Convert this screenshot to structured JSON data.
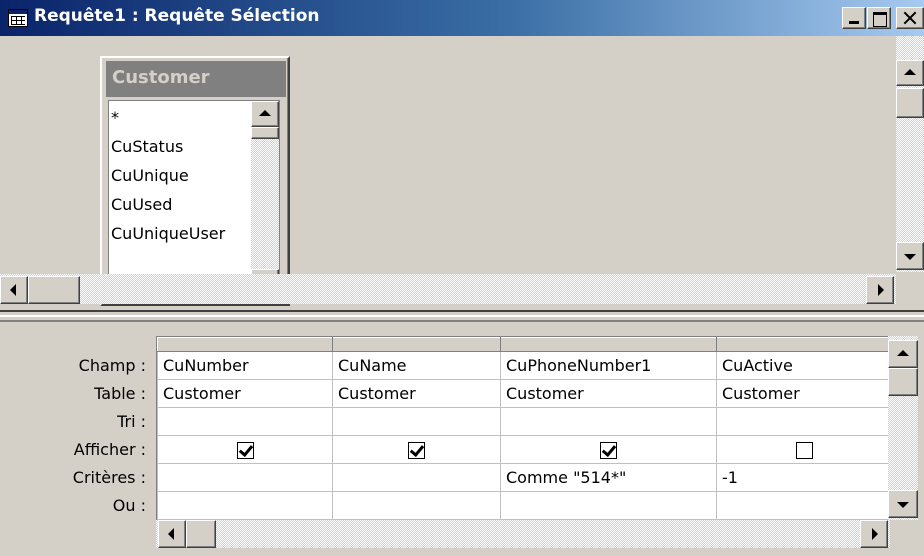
{
  "window": {
    "title": "Requête1 : Requête Sélection",
    "icon": "query-design-icon"
  },
  "field_list": {
    "table_name": "Customer",
    "items": [
      "*",
      "CuStatus",
      "CuUnique",
      "CuUsed",
      "CuUniqueUser"
    ]
  },
  "grid": {
    "row_labels": [
      "Champ :",
      "Table :",
      "Tri :",
      "Afficher :",
      "Critères :",
      "Ou :"
    ],
    "columns": [
      {
        "champ": "CuNumber",
        "table": "Customer",
        "tri": "",
        "afficher": true,
        "criteres": "",
        "ou": ""
      },
      {
        "champ": "CuName",
        "table": "Customer",
        "tri": "",
        "afficher": true,
        "criteres": "",
        "ou": ""
      },
      {
        "champ": "CuPhoneNumber1",
        "table": "Customer",
        "tri": "",
        "afficher": true,
        "criteres": "Comme \"514*\"",
        "ou": ""
      },
      {
        "champ": "CuActive",
        "table": "Customer",
        "tri": "",
        "afficher": false,
        "criteres": "-1",
        "ou": ""
      }
    ]
  }
}
